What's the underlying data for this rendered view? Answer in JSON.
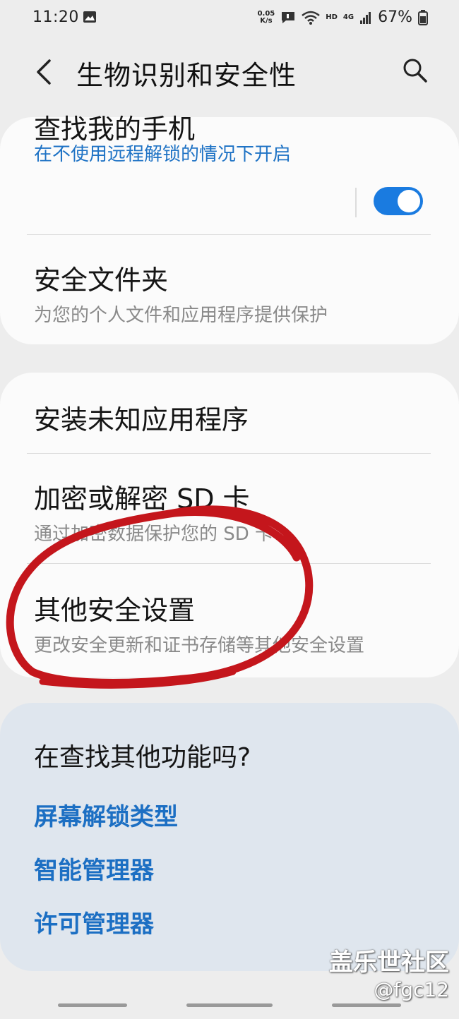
{
  "status_bar": {
    "time": "11:20",
    "speed_value": "0.05",
    "speed_unit": "K/s",
    "hd": "HD",
    "network": "4G",
    "battery": "67%"
  },
  "header": {
    "title": "生物识别和安全性"
  },
  "card1": {
    "find_phone_title": "查找我的手机",
    "find_phone_sub": "在不使用远程解锁的情况下开启",
    "find_phone_toggle_on": true,
    "secure_folder_title": "安全文件夹",
    "secure_folder_sub": "为您的个人文件和应用程序提供保护"
  },
  "card2": {
    "install_unknown_title": "安装未知应用程序",
    "encrypt_sd_title": "加密或解密 SD 卡",
    "encrypt_sd_sub": "通过加密数据保护您的 SD 卡",
    "other_security_title": "其他安全设置",
    "other_security_sub": "更改安全更新和证书存储等其他安全设置"
  },
  "suggestions": {
    "heading": "在查找其他功能吗?",
    "links": [
      "屏幕解锁类型",
      "智能管理器",
      "许可管理器"
    ]
  },
  "watermark": {
    "line1": "盖乐世社区",
    "line2": "@fgc12"
  },
  "colors": {
    "accent": "#1a7be0",
    "link": "#1c6fc3",
    "annotation": "#c4161c"
  }
}
